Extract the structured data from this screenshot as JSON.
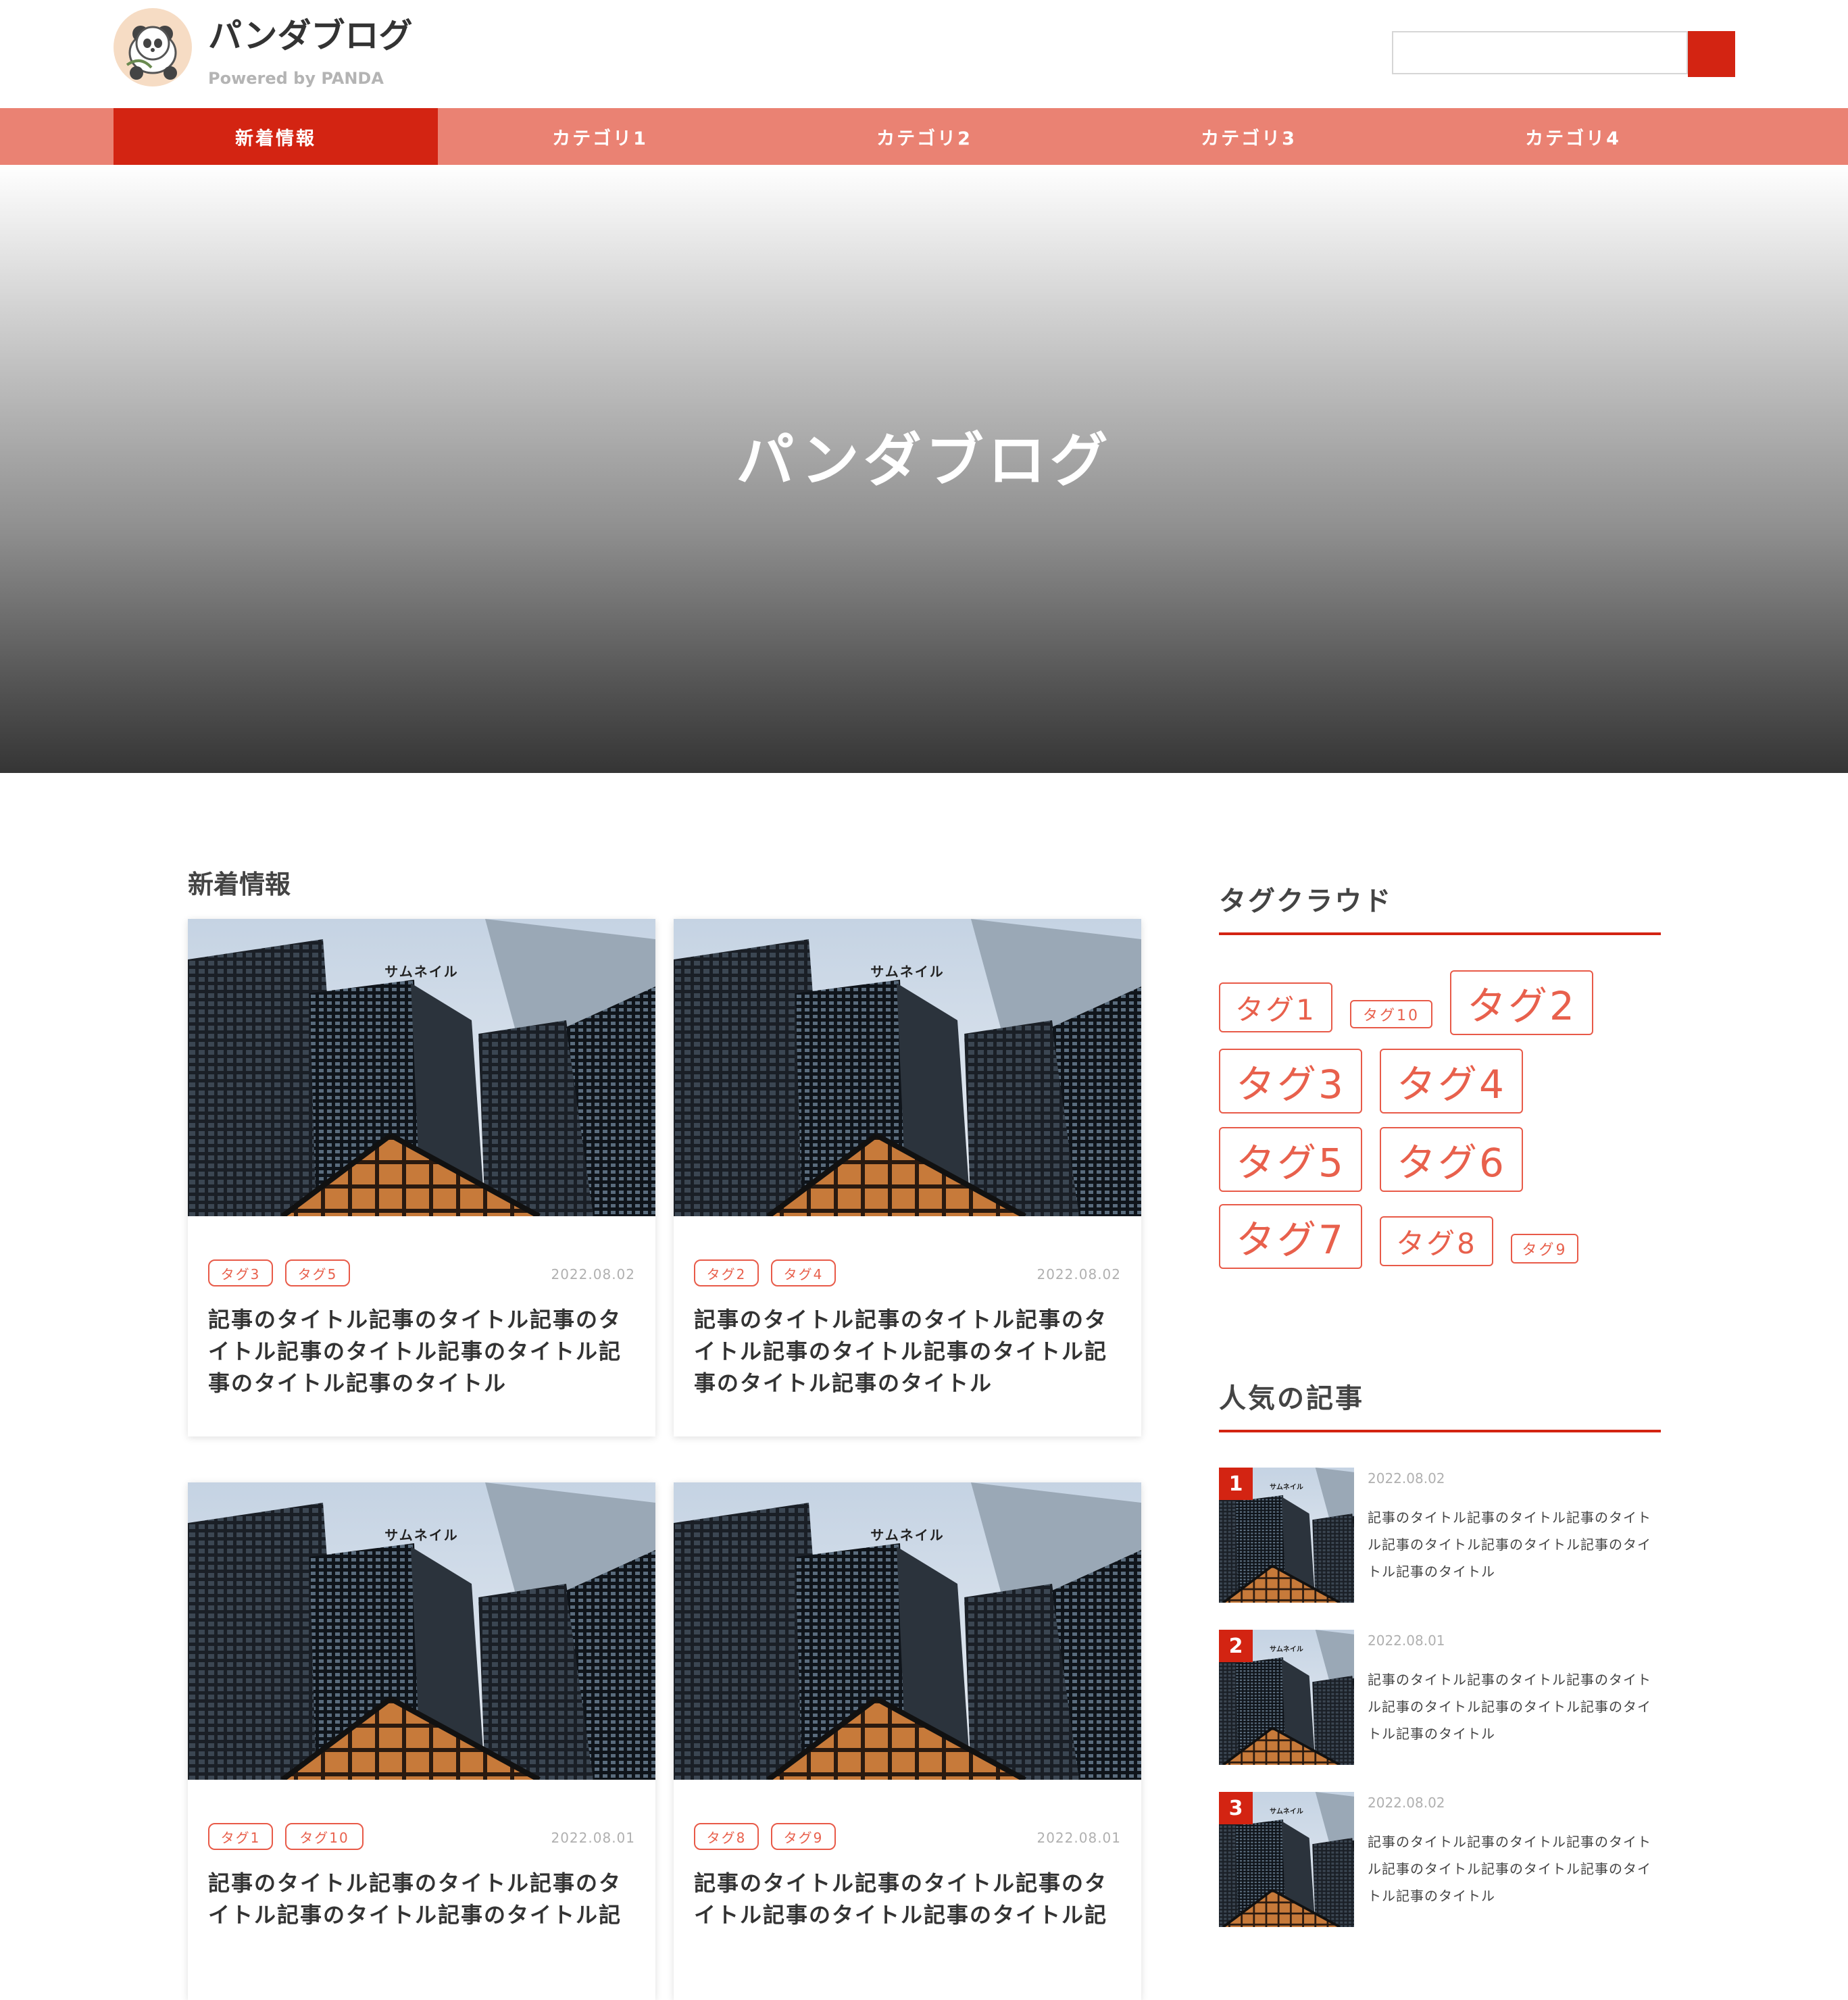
{
  "header": {
    "site_title": "パンダブログ",
    "site_sub": "Powered by PANDA",
    "search_placeholder": ""
  },
  "nav": {
    "items": [
      {
        "label": "新着情報",
        "active": true
      },
      {
        "label": "カテゴリ1"
      },
      {
        "label": "カテゴリ2"
      },
      {
        "label": "カテゴリ3"
      },
      {
        "label": "カテゴリ4"
      }
    ]
  },
  "hero": {
    "title": "パンダブログ"
  },
  "main": {
    "section_title": "新着情報",
    "thumb_label": "サムネイル",
    "cards": [
      {
        "tags": [
          "タグ3",
          "タグ5"
        ],
        "date": "2022.08.02",
        "title": "記事のタイトル記事のタイトル記事のタイトル記事のタイトル記事のタイトル記事のタイトル記事のタイトル"
      },
      {
        "tags": [
          "タグ2",
          "タグ4"
        ],
        "date": "2022.08.02",
        "title": "記事のタイトル記事のタイトル記事のタイトル記事のタイトル記事のタイトル記事のタイトル記事のタイトル"
      },
      {
        "tags": [
          "タグ1",
          "タグ10"
        ],
        "date": "2022.08.01",
        "title": "記事のタイトル記事のタイトル記事のタイトル記事のタイトル記事のタイトル記"
      },
      {
        "tags": [
          "タグ8",
          "タグ9"
        ],
        "date": "2022.08.01",
        "title": "記事のタイトル記事のタイトル記事のタイトル記事のタイトル記事のタイトル記"
      }
    ]
  },
  "sidebar": {
    "tagcloud_title": "タグクラウド",
    "tags": [
      "タグ1",
      "タグ10",
      "タグ2",
      "タグ3",
      "タグ4",
      "タグ5",
      "タグ6",
      "タグ7",
      "タグ8",
      "タグ9"
    ],
    "popular_title": "人気の記事",
    "popular_thumb_label": "サムネイル",
    "popular": [
      {
        "rank": "1",
        "date": "2022.08.02",
        "title": "記事のタイトル記事のタイトル記事のタイトル記事のタイトル記事のタイトル記事のタイトル記事のタイトル"
      },
      {
        "rank": "2",
        "date": "2022.08.01",
        "title": "記事のタイトル記事のタイトル記事のタイトル記事のタイトル記事のタイトル記事のタイトル記事のタイトル"
      },
      {
        "rank": "3",
        "date": "2022.08.02",
        "title": "記事のタイトル記事のタイトル記事のタイトル記事のタイトル記事のタイトル記事のタイトル記事のタイトル"
      }
    ]
  },
  "colors": {
    "accent": "#d32412",
    "nav_bg": "#ea8273",
    "tag": "#e8604c"
  }
}
